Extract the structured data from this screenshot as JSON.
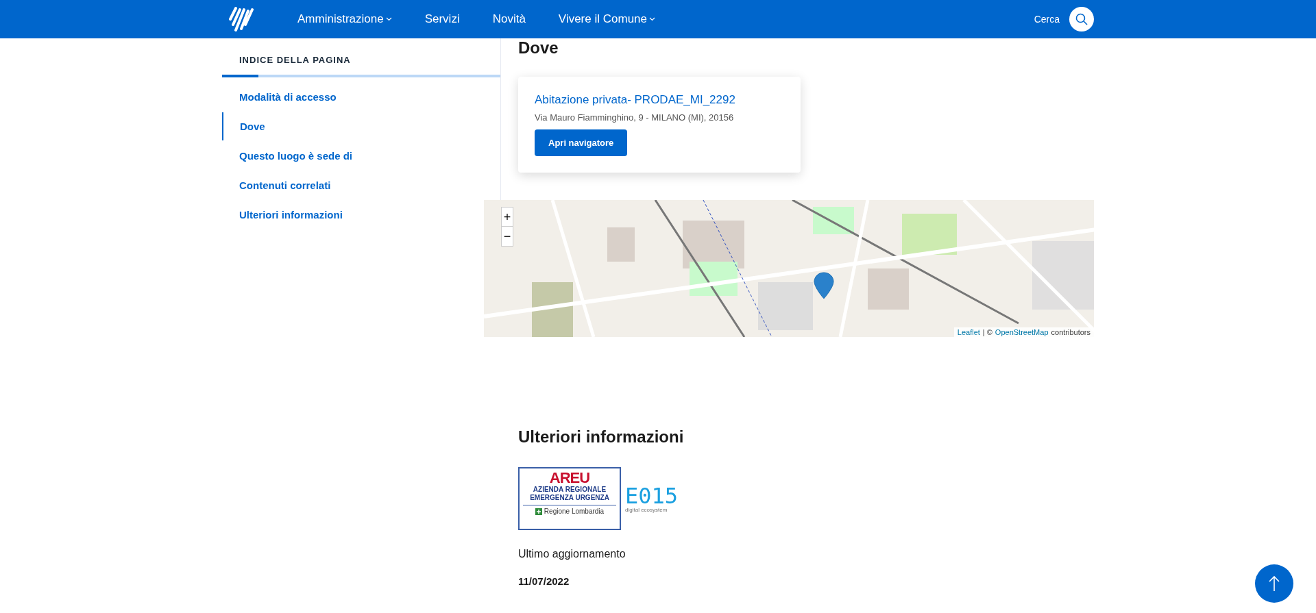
{
  "header": {
    "nav": [
      {
        "label": "Amministrazione",
        "dropdown": true
      },
      {
        "label": "Servizi",
        "dropdown": false
      },
      {
        "label": "Novità",
        "dropdown": false
      },
      {
        "label": "Vivere il Comune",
        "dropdown": true
      }
    ],
    "search_label": "Cerca"
  },
  "sidebar": {
    "title": "INDICE DELLA PAGINA",
    "progress": {
      "level": 0.13
    },
    "items": [
      {
        "label": "Modalità di accesso",
        "selected": false
      },
      {
        "label": "Dove",
        "selected": true
      },
      {
        "label": "Questo luogo è sede di",
        "selected": false
      },
      {
        "label": "Contenuti correlati",
        "selected": false
      },
      {
        "label": "Ulteriori informazioni",
        "selected": false
      }
    ]
  },
  "dove": {
    "heading": "Dove",
    "card": {
      "title": "Abitazione privata- PRODAE_MI_2292",
      "address": "Via Mauro Fiamminghino, 9 - MILANO (MI), 20156",
      "button": "Apri navigatore"
    },
    "map": {
      "zoom_in": "+",
      "zoom_out": "−",
      "attribution_link_1": "Leaflet",
      "attribution_sep": "| ©",
      "attribution_link_2": "OpenStreetMap",
      "attribution_text": "contributors"
    }
  },
  "ulteriori": {
    "heading": "Ulteriori informazioni",
    "logo_areu": {
      "name": "AREU",
      "line_1": "AZIENDA REGIONALE",
      "line_2": "EMERGENZA URGENZA",
      "region": "Regione Lombardia"
    },
    "logo_e015": {
      "name": "E015",
      "tagline": "digital ecosystem"
    },
    "updated_label": "Ultimo aggiornamento",
    "updated_date": "11/07/2022"
  }
}
